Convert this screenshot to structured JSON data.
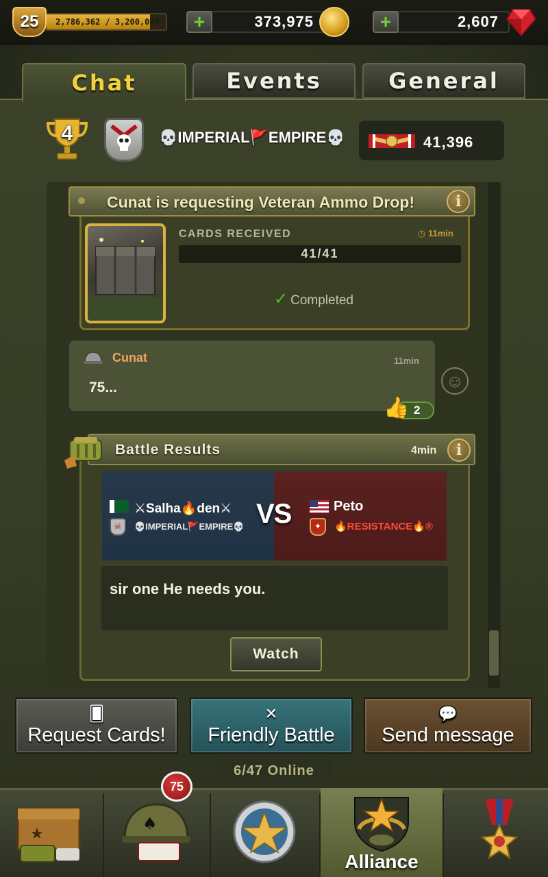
{
  "top_bar": {
    "level": "25",
    "xp_text": "2,786,362 / 3,200,000",
    "xp_progress": 0.87,
    "coins": "373,975",
    "rubies": "2,607",
    "plus_symbol": "+"
  },
  "tabs": [
    {
      "label": "Chat",
      "active": true
    },
    {
      "label": "Events",
      "active": false
    },
    {
      "label": "General",
      "active": false
    }
  ],
  "alliance": {
    "rank": "4",
    "name": "💀IMPERIAL🚩EMPIRE💀",
    "score": "41,396"
  },
  "request": {
    "title": "Cunat is requesting Veteran Ammo Drop!",
    "cards_label": "CARDS RECEIVED",
    "time": "11min",
    "count": "41/41",
    "status": "Completed",
    "info_symbol": "i"
  },
  "message": {
    "author": "Cunat",
    "time": "11min",
    "text": "75...",
    "likes": "2"
  },
  "battle": {
    "title": "Battle Results",
    "time": "4min",
    "player1": "⚔Salha🔥den⚔",
    "player1_alliance": "💀IMPERIAL🚩EMPIRE💀",
    "vs": "VS",
    "player2": "Peto",
    "player2_alliance": "🔥RESISTANCE🔥®",
    "message": "sir one He needs you.",
    "watch_label": "Watch"
  },
  "actions": {
    "request_cards": "Request Cards!",
    "friendly_battle": "Friendly Battle",
    "send_message": "Send message"
  },
  "online": "6/47  Online",
  "bottom_nav": {
    "badge": "75",
    "active_label": "Alliance"
  },
  "colors": {
    "accent_gold": "#f2d23a",
    "panel": "#3c4229",
    "resistance_red": "#ff4a3a",
    "author_orange": "#f2a45c"
  }
}
